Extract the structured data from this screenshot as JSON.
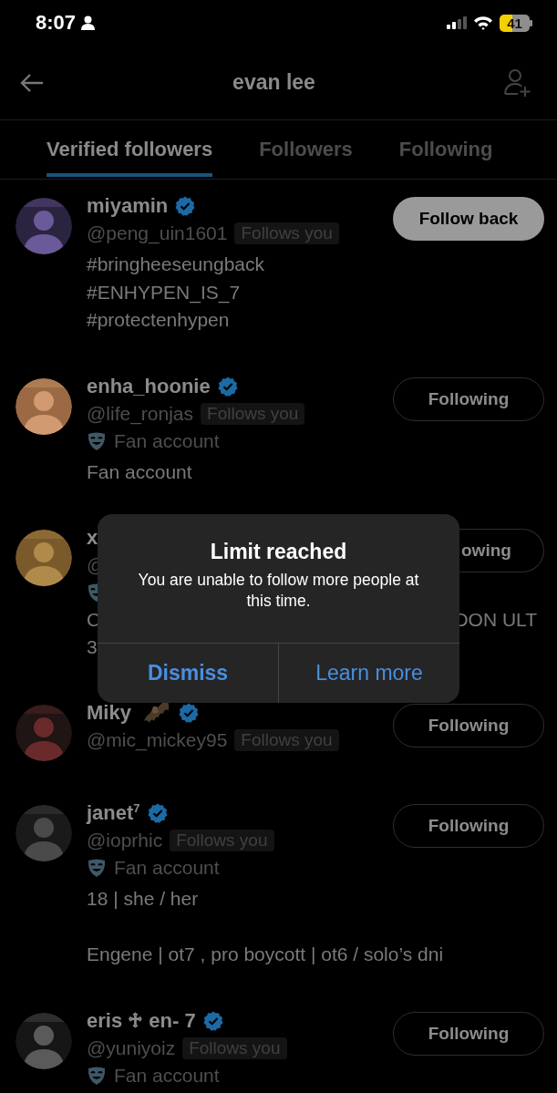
{
  "status_bar": {
    "time": "8:07",
    "battery": "41"
  },
  "header": {
    "title": "evan lee"
  },
  "tabs": [
    {
      "label": "Verified followers",
      "selected": true
    },
    {
      "label": "Followers",
      "selected": false
    },
    {
      "label": "Following",
      "selected": false
    }
  ],
  "users": [
    {
      "name": "miyamin",
      "verified": true,
      "handle": "@peng_uin1601",
      "follows_you": "Follows you",
      "bio": "#bringheeseungback\n#ENHYPEN_IS_7\n#protectenhypen",
      "button": {
        "label": "Follow back",
        "kind": "follow"
      }
    },
    {
      "name": "enha_hoonie",
      "verified": true,
      "handle": "@life_ronjas",
      "follows_you": "Follows you",
      "fan_account": true,
      "category": "Fan account",
      "bio": "Fan account",
      "button": {
        "label": "Following",
        "kind": "following"
      }
    },
    {
      "name": "x",
      "covered": true,
      "handle": "@",
      "fan_account": true,
      "bio_fragments": [
        [
          "C",
          "DON ULT"
        ],
        [
          "3"
        ]
      ],
      "button": {
        "label": "owing",
        "kind": "following"
      }
    },
    {
      "name": "Miky",
      "emoji_icon": true,
      "verified": true,
      "handle": "@mic_mickey95",
      "follows_you": "Follows you",
      "button": {
        "label": "Following",
        "kind": "following"
      }
    },
    {
      "name": "janet$^{7}$",
      "verified": true,
      "handle": "@ioprhic",
      "follows_you": "Follows you",
      "fan_account": true,
      "category": "Fan account",
      "bio": "18 | she / her\n\nEngene | ot7 , pro boycott | ot6 / solo’s dni",
      "button": {
        "label": "Following",
        "kind": "following"
      }
    },
    {
      "name": "eris ♱ en- 7",
      "verified": true,
      "handle": "@yuniyoiz",
      "follows_you": "Follows you",
      "fan_account": true,
      "category": "Fan account",
      "button": {
        "label": "Following",
        "kind": "following"
      }
    }
  ],
  "dialog": {
    "title": "Limit reached",
    "message": "You are unable to follow more people at this time.",
    "buttons": [
      {
        "label": "Dismiss",
        "kind": "primary"
      },
      {
        "label": "Learn more",
        "kind": "secondary"
      }
    ]
  }
}
